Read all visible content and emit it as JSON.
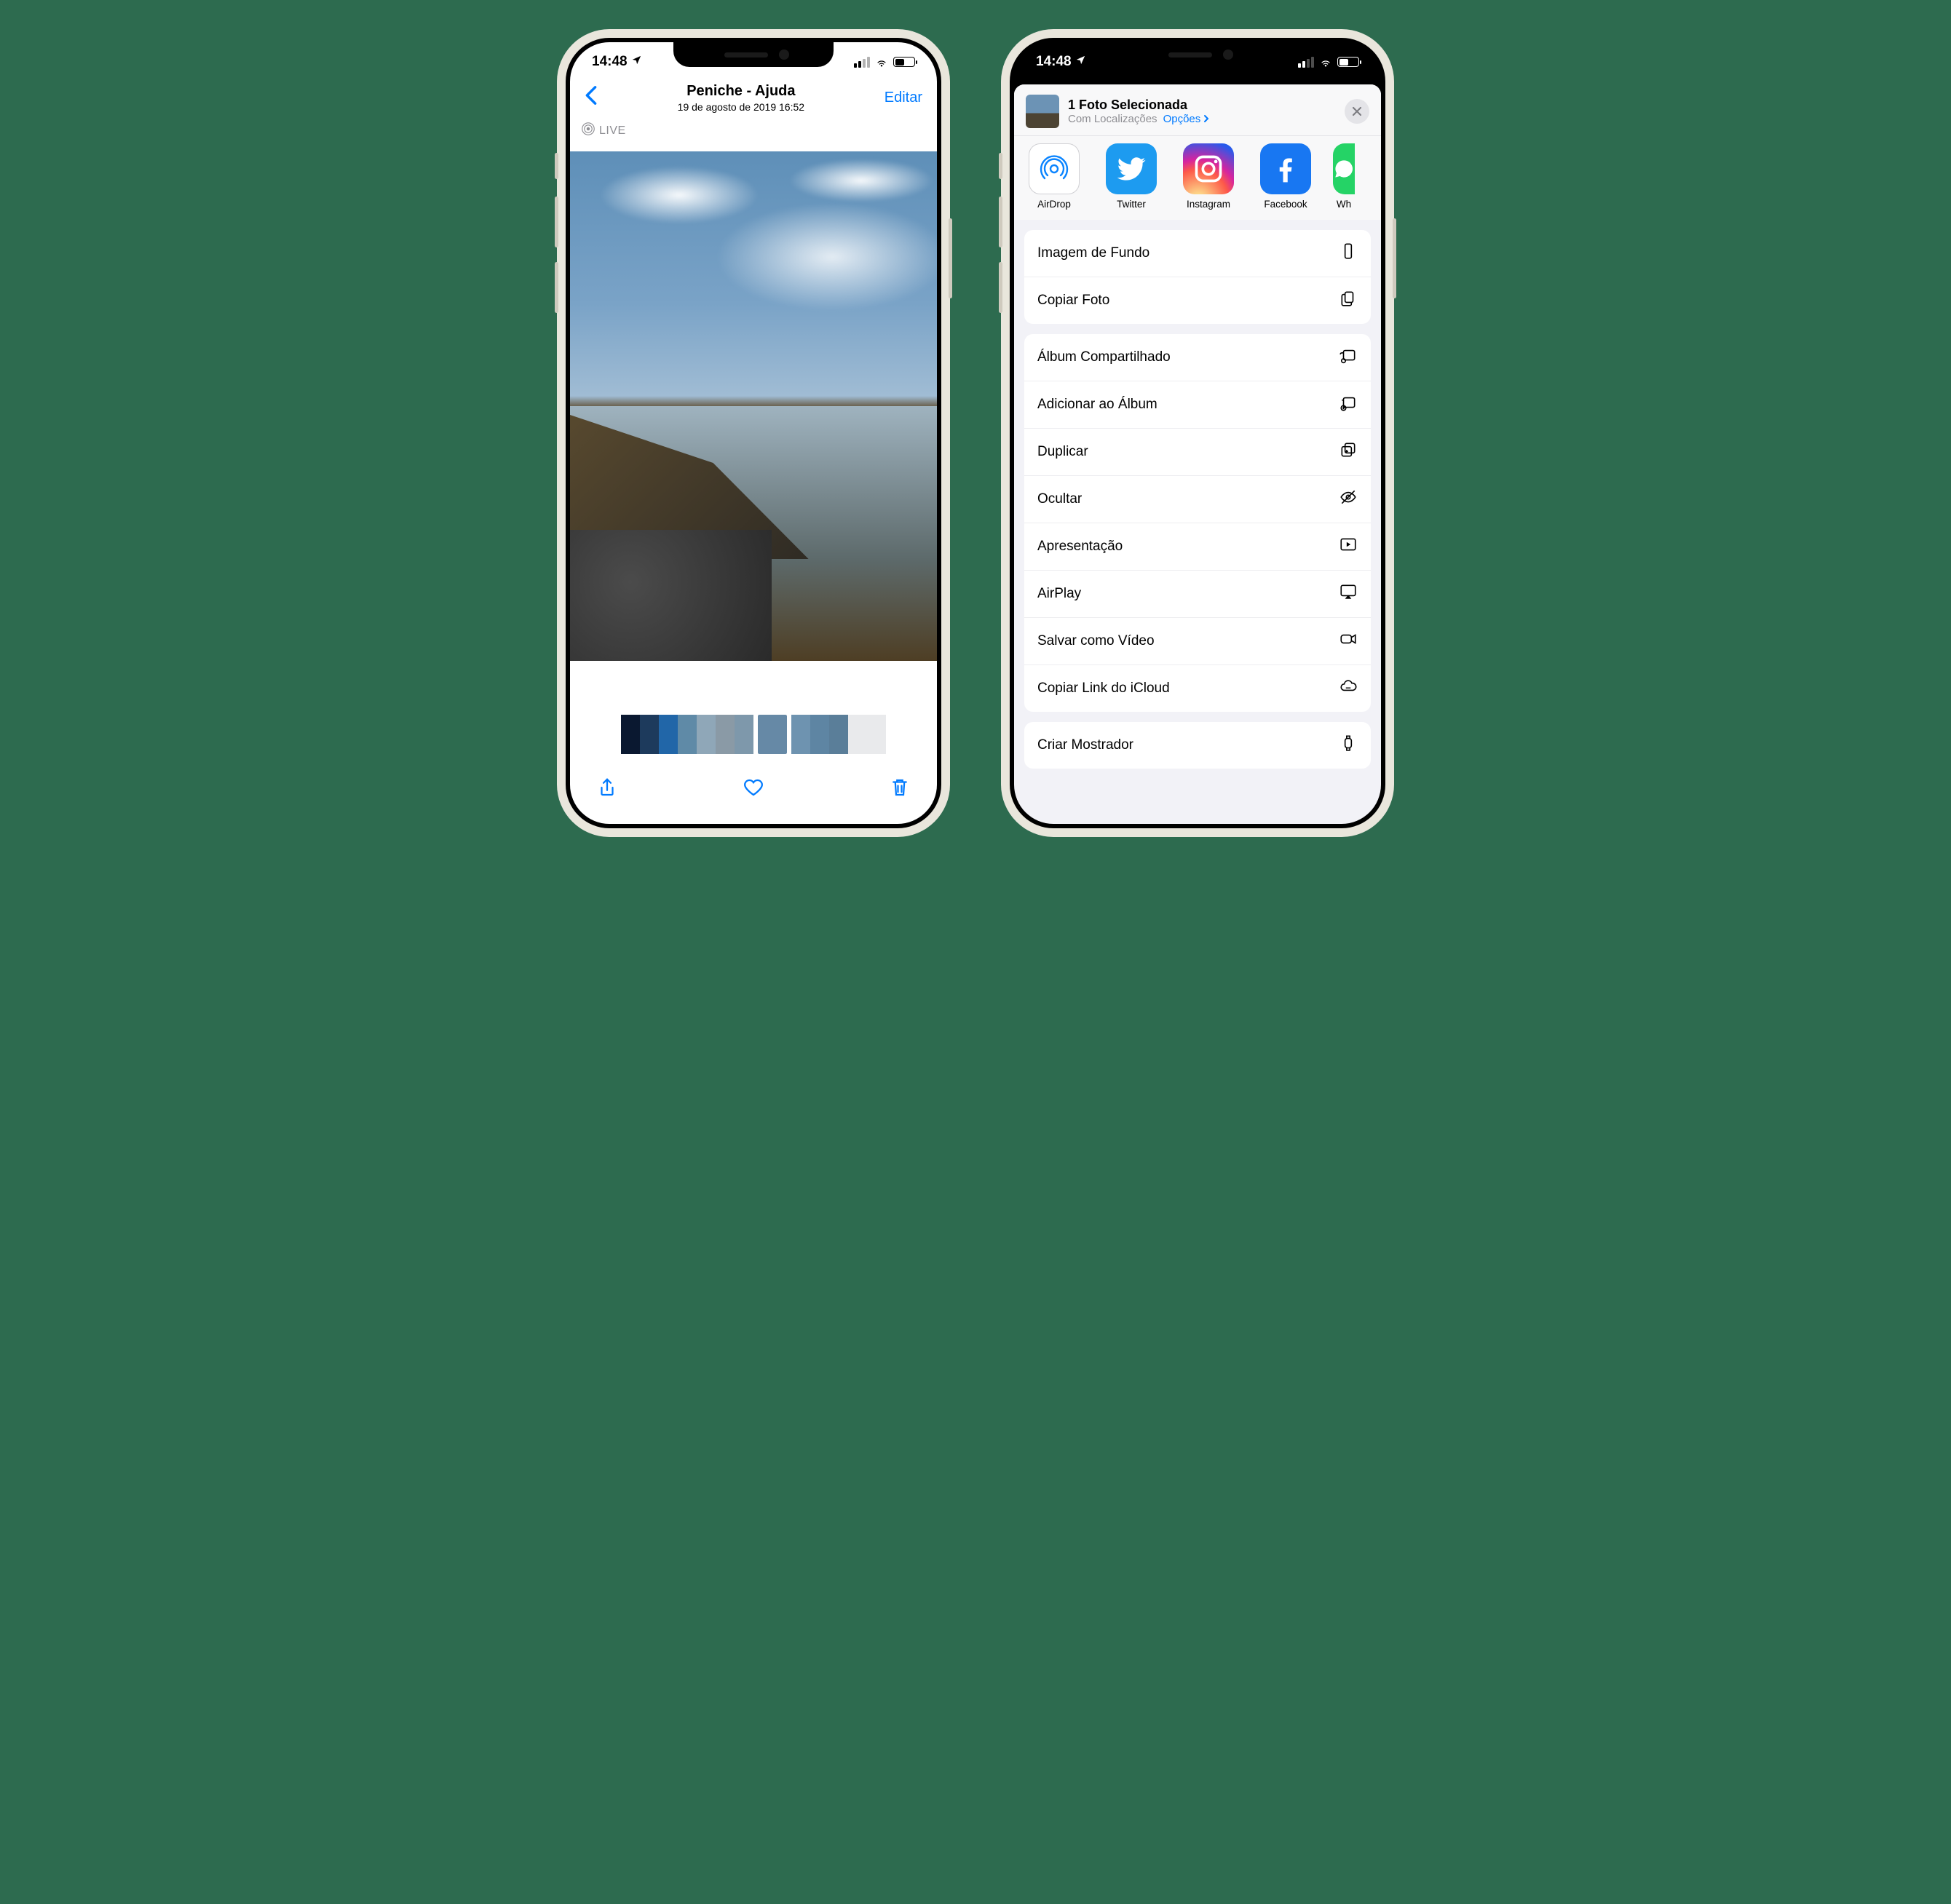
{
  "status": {
    "time": "14:48"
  },
  "left": {
    "nav": {
      "title": "Peniche - Ajuda",
      "subtitle": "19 de agosto de 2019  16:52",
      "edit": "Editar"
    },
    "live_label": "LIVE"
  },
  "right": {
    "header": {
      "title": "1 Foto Selecionada",
      "subtitle": "Com Localizações",
      "options": "Opções"
    },
    "apps": [
      {
        "label": "AirDrop"
      },
      {
        "label": "Twitter"
      },
      {
        "label": "Instagram"
      },
      {
        "label": "Facebook"
      },
      {
        "label": "Wh"
      }
    ],
    "group1": [
      {
        "label": "Imagem de Fundo",
        "icon": "phone"
      },
      {
        "label": "Copiar Foto",
        "icon": "copy"
      }
    ],
    "group2": [
      {
        "label": "Álbum Compartilhado",
        "icon": "shared-album"
      },
      {
        "label": "Adicionar ao Álbum",
        "icon": "add-album"
      },
      {
        "label": "Duplicar",
        "icon": "duplicate"
      },
      {
        "label": "Ocultar",
        "icon": "hide"
      },
      {
        "label": "Apresentação",
        "icon": "slideshow"
      },
      {
        "label": "AirPlay",
        "icon": "airplay"
      },
      {
        "label": "Salvar como Vídeo",
        "icon": "video"
      },
      {
        "label": "Copiar Link do iCloud",
        "icon": "cloud-link"
      }
    ],
    "group3": [
      {
        "label": "Criar Mostrador",
        "icon": "watch"
      }
    ]
  }
}
